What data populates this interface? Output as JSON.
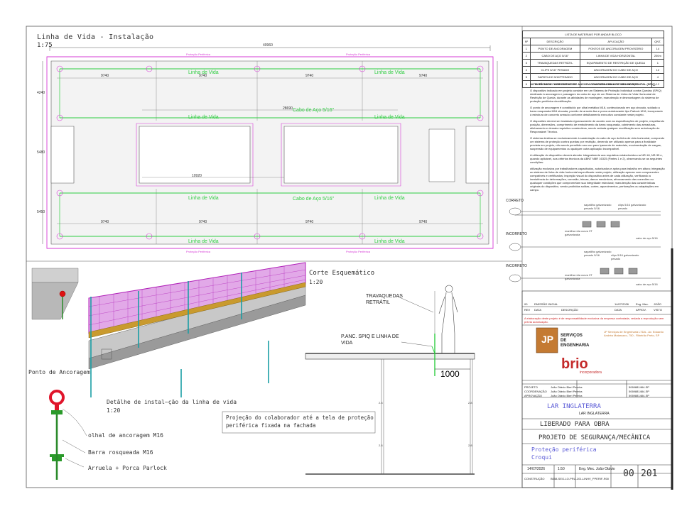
{
  "plan": {
    "title": "Linha de Vida - Instalação",
    "scale": "1:75",
    "linha_label": "Linha de Vida",
    "cabo_label": "Cabo de Aço 5/16\"",
    "protecao_label": "Proteção Periferica",
    "dims": {
      "total": "40960",
      "seg": "9740",
      "d1": "28690",
      "d2": "10920",
      "v1": "4240",
      "v2": "5480",
      "v3": "5450"
    }
  },
  "bom": {
    "title": "LISTA DE MATERIAIS POR ANDAR BLOCO",
    "headers": [
      "Nº",
      "DESCRIÇÃO",
      "APLICAÇÃO",
      "QNT."
    ],
    "rows": [
      [
        "1",
        "PONTO DE ANCORAGEM",
        "PONTOS DE ANCORAGEM PROVISÓRIO",
        "14"
      ],
      [
        "2",
        "CABO DE AÇO 5/16\"",
        "LINHA DE VIDA HORIZONTAL",
        "200m"
      ],
      [
        "3",
        "TRAVAQUEDAS RETRÁTIL",
        "EQUIPAMENTO DE RESTRIÇÃO DE QUEDA",
        "1"
      ],
      [
        "4",
        "CLIPS 5/16\" PESADO",
        "ANCORAGEM DO CABO DE AÇO",
        "12"
      ],
      [
        "5",
        "SAPATILHO 5/16\"PESADO",
        "ANCORAGEM DO CABO DE AÇO",
        "4"
      ],
      [
        "6",
        "MANILHA RETA DU CURVA 3T",
        "ANCORAGEM DO CABO DE AÇO",
        "12"
      ]
    ]
  },
  "notes": {
    "title": "NOTA TÉCNICA – DISPOSITIVO DE ANCORAGEM PARA LINHA DE VIDA HORIZONTAL (SPIQ)",
    "p1": "O dispositivo indicado em projeto consiste em um Sistema de Proteção Individual contra Quedas (SPIQ) destinado à ancoragem e passagem do cabo de aço de um Sistema de Linha de Vida Horizontal de Restrição de Queda, durante as atividades de montagem, manutenção e desmontagem do sistema de proteção periférica da edificação.",
    "p2": "O ponto de ancoragem é constituído por olhal metálico M16, confeccionado em aço zincado, soldado a barra rosqueada M16 zincada, provido de arruela lisa e porca autotravante tipo Parlock M16, incorporado à estrutura de concreto armado conforme detalhamento executivo constante neste projeto.",
    "p3": "O dispositivo deverá ser instalado rigorosamente de acordo com as especificações de projeto, respeitando posição, dimensões, comprimento de embutimento da barra rosqueada, cobrimento das armaduras, alinhamento e demais requisitos construtivos, sendo vedada qualquer modificação sem autorização do Responsável Técnico.",
    "p4": "O sistema destina-se exclusivamente à sustentação do cabo de aço da linha de vida horizontal, compondo um sistema de proteção contra quedas por restrição, devendo ser utilizado apenas para a finalidade prevista em projeto, não sendo permitido seu uso para içamento de materiais, movimentação de cargas, suspensão de equipamentos ou qualquer outra aplicação incompatível.",
    "p5": "A utilização do dispositivo deverá atender integralmente aos requisitos estabelecidos na NR-18, NR-35 e, quando aplicável, aos critérios técnicos da ABNT NBR 16325 (Partes 1 e 2), observando-se as seguintes condições:",
    "p6": "utilização exclusiva por trabalhadores capacitados, autorizados e aptos para trabalho em altura; integração ao sistema de linha de vida horizontal especificado neste projeto; utilização apenas com componentes compatíveis e certificados; inspeção visual do dispositivo antes de cada utilização, verificando a inexistência de deformações, corrosão, trincas, danos mecânicos, afrouxamento das conexões ou quaisquer condições que comprometam sua integridade estrutural; manutenção das características originais do dispositivo, sendo proibidas soldas, cortes, aquecimentos, perfurações ou adaptações em campo."
  },
  "terminals": {
    "correto": "CORRETO",
    "incorreto1": "INCORRETO",
    "incorreto2": "INCORRETO",
    "sapatilho1": "sapatilho galvanizado pesado 5/16",
    "clips1": "clips 5/16 galvanizado pesado",
    "manilha1": "manilha reta curva 3T galvanizada",
    "cabo1": "cabo de aço 5/16",
    "sapatilho2": "sapatilho galvanizado pesado 5/16",
    "clips2": "clips 5/16 galvanizado pesado",
    "manilha2": "manilha reta curva 3T galvanizada",
    "cabo2": "cabo de aço 5/16"
  },
  "section": {
    "title": "Corte Esquemático",
    "scale": "1:20",
    "travaquedas": "TRAVAQUEDAS RETRÁTIL",
    "panc": "P.ANC. SPIQ E LINHA DE VIDA",
    "dim": "1000",
    "dim_small": "2.8"
  },
  "detail": {
    "ponto": "Ponto de Ancoragem",
    "title": "Detalhe de instalação da linha de vida",
    "title_rendered": "Detâlhe de instal~ção da linha de vida",
    "scale": "1:20",
    "note": "Projeção do colaborador até a tela de proteção periférica fixada na fachada",
    "olhal": "olhal de ancoragem M16",
    "barra": "Barra rosqueada M16",
    "arruela": "Arruela + Porca Parlock"
  },
  "titleblock": {
    "rev_headers": [
      "REV",
      "DATA",
      "DESCRIÇÃO",
      "DATA",
      "APROV.",
      "VISTO"
    ],
    "rev_row": [
      "00",
      "EMISSÃO INICIAL",
      "14/07/2026",
      "Eng. Mec.",
      "JOÃO"
    ],
    "warning": "A elaboração deste projeto é de responsabilidade exclusiva da empresa contratada, vedada a reprodução sem prévia autorização.",
    "company_name": "SERVIÇOS DE ENGENHARIA",
    "company_addr": "JP Serviços de Engenharia LTDA - Av. Eduardo Andréa Matarazzo, 750 - Ribeirão Preto, SP",
    "client_logo": "brio",
    "client_sub": "incorporadora",
    "people": [
      [
        "PROJETO",
        "João Otávio Bieri Pereira",
        "5069881484-SP"
      ],
      [
        "COORDENAÇÃO",
        "João Otávio Bieri Pereira",
        "5069881484-SP"
      ],
      [
        "APROVAÇÃO",
        "João Otávio Bieri Pereira",
        "5069881484-SP"
      ]
    ],
    "obra": "LAR INGLATERRA",
    "obra_sub": "LAR INGLATERRA",
    "status": "LIBERADO PARA OBRA",
    "project": "PROJETO DE SEGURANÇA/MECÂNICA",
    "drawing": "Proteção periférica",
    "drawing_sub": "Croqui",
    "date": "14/07/2026",
    "scale": "1:50",
    "engineer": "Eng. Mec. João Otávio",
    "rev": "00",
    "sheet": "201",
    "code": "B058-SEG-LO-PRU-201-LINHV_PPERIF-R00",
    "construcao": "CONSTRUÇÃO"
  }
}
